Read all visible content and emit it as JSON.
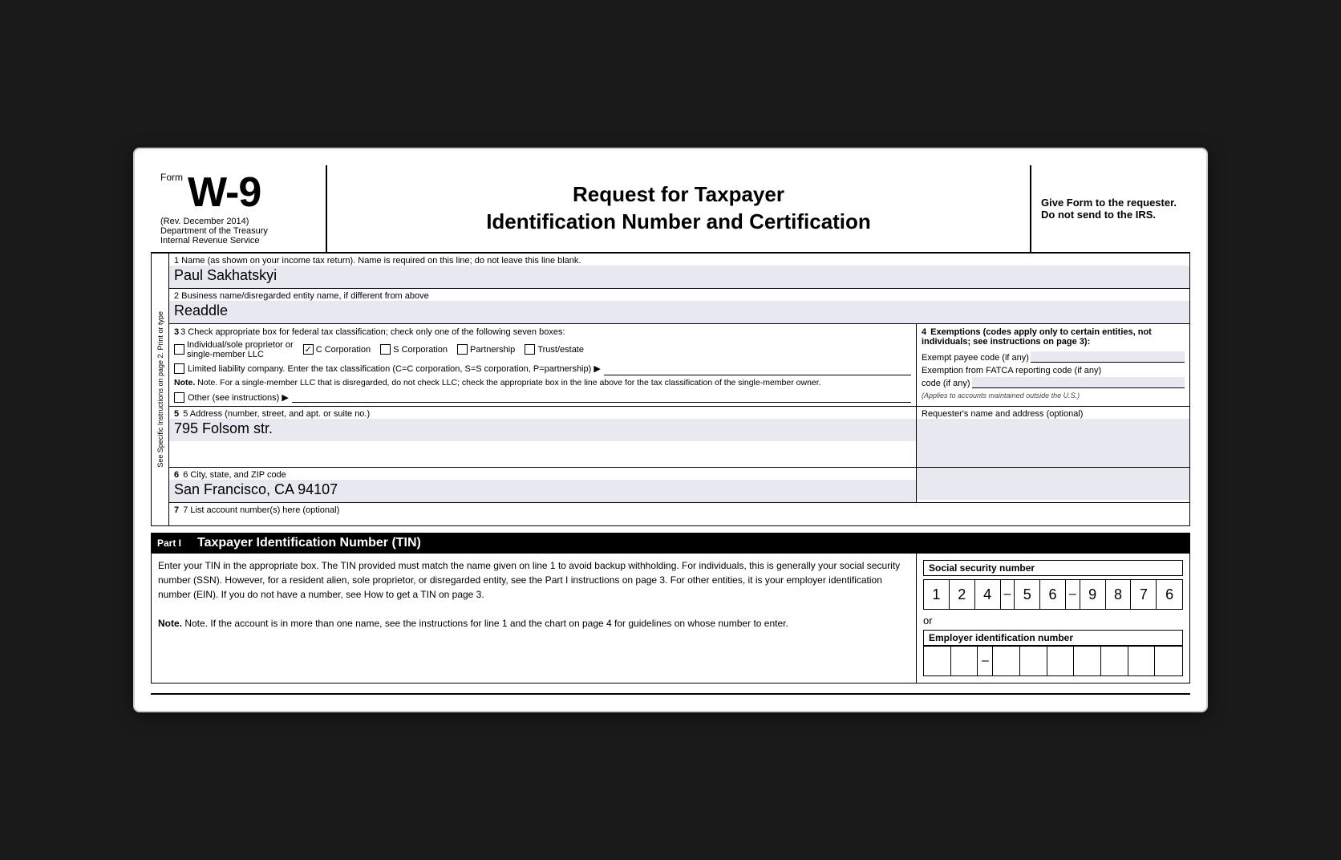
{
  "header": {
    "form_label": "Form",
    "form_number": "W-9",
    "rev": "(Rev. December 2014)",
    "dept1": "Department of the Treasury",
    "dept2": "Internal Revenue Service",
    "title_line1": "Request for Taxpayer",
    "title_line2": "Identification Number and Certification",
    "right_text": "Give Form to the requester. Do not send to the IRS."
  },
  "sidebar": {
    "text": "See Specific Instructions on page 2. Print or type"
  },
  "fields": {
    "field1_label": "1  Name (as shown on your income tax return). Name is required on this line; do not leave this line blank.",
    "field1_value": "Paul Sakhatskyi",
    "field2_label": "2  Business name/disregarded entity name, if different from above",
    "field2_value": "Readdle",
    "field3_label": "3  Check appropriate box for federal tax classification; check only one of the following seven boxes:",
    "tax_options": [
      {
        "id": "individual",
        "label": "Individual/sole proprietor or single-member LLC",
        "checked": false
      },
      {
        "id": "c_corp",
        "label": "C Corporation",
        "checked": true
      },
      {
        "id": "s_corp",
        "label": "S Corporation",
        "checked": false
      },
      {
        "id": "partnership",
        "label": "Partnership",
        "checked": false
      },
      {
        "id": "trust",
        "label": "Trust/estate",
        "checked": false
      }
    ],
    "llc_label": "Limited liability company. Enter the tax classification (C=C corporation, S=S corporation, P=partnership) ▶",
    "note_text": "Note. For a single-member LLC that is disregarded, do not check LLC; check the appropriate box in the line above for the tax classification of the single-member owner.",
    "other_label": "Other (see instructions) ▶",
    "field4_label": "4  Exemptions (codes apply only to certain entities, not individuals; see instructions on page 3):",
    "exempt_payee_label": "Exempt payee code (if any)",
    "fatca_label": "Exemption from FATCA reporting code (if any)",
    "fatca_note": "(Applies to accounts maintained outside the U.S.)",
    "field5_label": "5  Address (number, street, and apt. or suite no.)",
    "field5_value": "795 Folsom str.",
    "requester_label": "Requester's name and address (optional)",
    "field6_label": "6  City, state, and ZIP code",
    "field6_value": "San Francisco, CA 94107",
    "field7_label": "7  List account number(s) here (optional)",
    "part1_label": "Part I",
    "part1_title": "Taxpayer Identification Number (TIN)",
    "part1_text1": "Enter your TIN in the appropriate box. The TIN provided must match the name given on line 1 to avoid backup withholding. For individuals, this is generally your social security number (SSN). However, for a resident alien, sole proprietor, or disregarded entity, see the Part I instructions on page 3. For other entities, it is your employer identification number (EIN). If you do not have a number, see How to get a TIN on page 3.",
    "part1_text2": "Note. If the account is in more than one name, see the instructions for line 1 and the chart on page 4 for guidelines on whose number to enter.",
    "ssn_label": "Social security number",
    "ssn_digits": [
      "1",
      "2",
      "4",
      "-",
      "5",
      "6",
      "-",
      "9",
      "8",
      "7",
      "6"
    ],
    "or_label": "or",
    "ein_label": "Employer identification number",
    "ein_digits": [
      "",
      "",
      "",
      "-",
      "",
      "",
      "",
      "",
      "",
      ""
    ]
  }
}
